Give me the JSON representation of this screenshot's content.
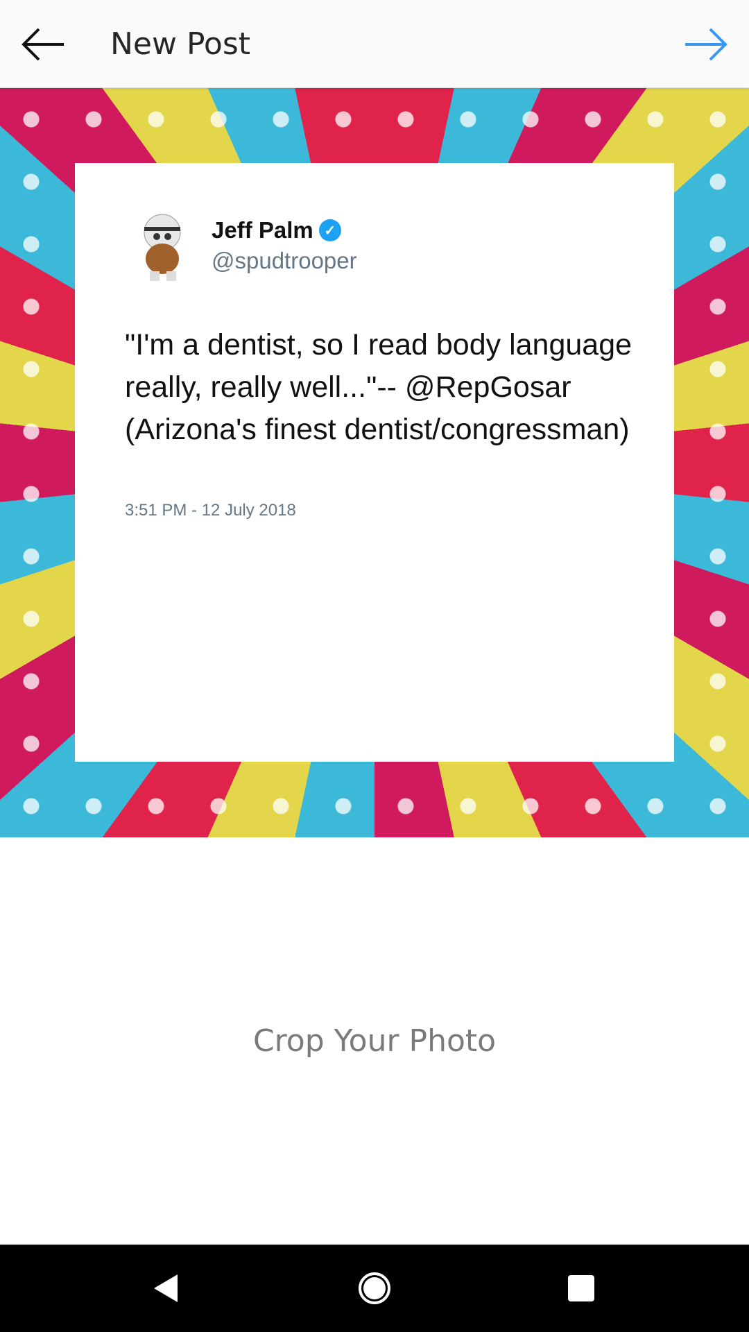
{
  "header": {
    "title": "New Post",
    "back_icon": "arrow-left-icon",
    "next_icon": "arrow-right-icon",
    "next_color": "#3897f0"
  },
  "tweet": {
    "name": "Jeff Palm",
    "verified_icon": "verified-badge-icon",
    "handle": "@spudtrooper",
    "text": "\"I'm a dentist, so I read body language really, really well...\"-- @RepGosar (Arizona's finest dentist/congressman)",
    "timestamp": "3:51 PM - 12 July 2018"
  },
  "crop_label": "Crop Your Photo",
  "navbar": {
    "back_icon": "triangle-back-icon",
    "home_icon": "circle-home-icon",
    "recents_icon": "square-recents-icon"
  }
}
